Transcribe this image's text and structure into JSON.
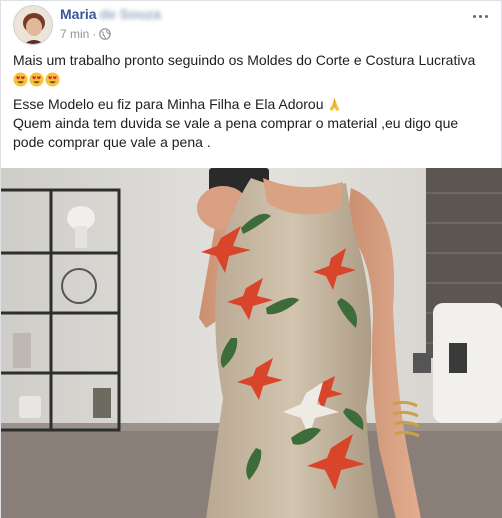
{
  "post": {
    "author": {
      "first_name": "Maria",
      "last_name_blurred": "de Souza",
      "avatar_icon": "avatar-photo"
    },
    "meta": {
      "time": "7 min",
      "separator": "·",
      "audience_icon": "globe-icon"
    },
    "menu_icon": "more-options-icon",
    "text": {
      "line1": "Mais um trabalho pronto seguindo os Moldes do Corte e Costura Lucrativa",
      "line1_emojis": [
        "heart-eyes-emoji",
        "heart-eyes-emoji",
        "heart-eyes-emoji"
      ],
      "line2": "Esse Modelo eu fiz para Minha Filha e Ela Adorou",
      "line2_emoji": "praying-hands-emoji",
      "line3": "Quem ainda tem duvida se vale a pena comprar o material ,eu digo que pode comprar que vale a pena ."
    },
    "photo": {
      "icon": "mirror-selfie-photo",
      "colors": {
        "wall": "#d9d7d2",
        "floor": "#8a7f78",
        "dress": "#c8b9a4",
        "flower_red": "#d9452a",
        "leaf_green": "#3d6b3a",
        "skin": "#d8a283",
        "shelf": "#3a3a3a"
      }
    }
  }
}
